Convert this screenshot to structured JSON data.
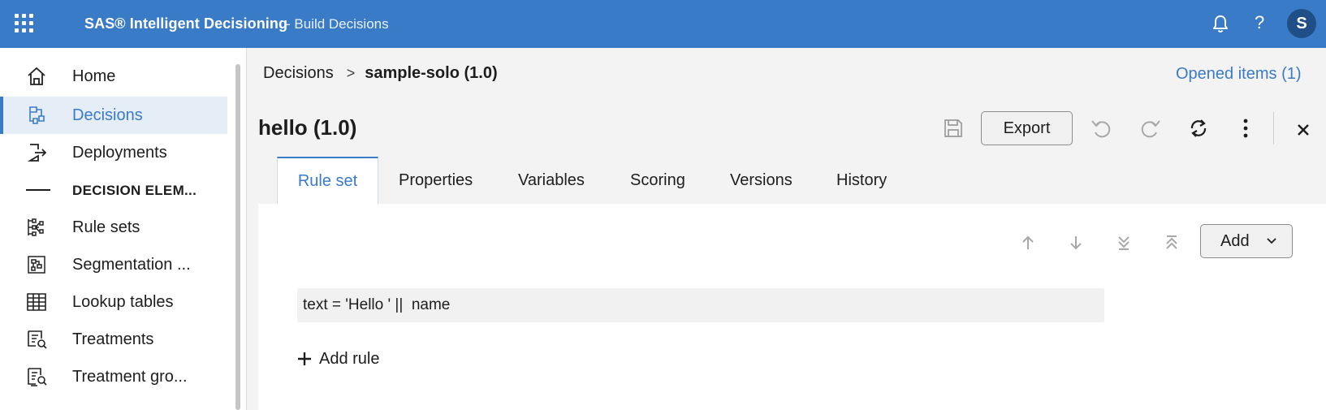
{
  "app": {
    "brand": "SAS® Intelligent Decisioning",
    "subtitle": "- Build Decisions",
    "help": "?",
    "user_initial": "S",
    "accent": "#3a7bc8"
  },
  "sidebar": {
    "items": [
      {
        "label": "Home",
        "icon": "home-icon"
      },
      {
        "label": "Decisions",
        "icon": "decisions-icon",
        "active": true
      },
      {
        "label": "Deployments",
        "icon": "deployments-icon"
      },
      {
        "label": "DECISION ELEM...",
        "icon": "dash-icon",
        "heading": true
      },
      {
        "label": "Rule sets",
        "icon": "rule-sets-icon"
      },
      {
        "label": "Segmentation ...",
        "icon": "segmentation-icon"
      },
      {
        "label": "Lookup tables",
        "icon": "lookup-table-icon"
      },
      {
        "label": "Treatments",
        "icon": "treatments-icon"
      },
      {
        "label": "Treatment gro...",
        "icon": "treatment-groups-icon"
      }
    ]
  },
  "breadcrumb": {
    "parent": "Decisions",
    "separator": ">",
    "current": "sample-solo (1.0)"
  },
  "opened_items": "Opened items (1)",
  "object": {
    "title": "hello (1.0)",
    "export_label": "Export"
  },
  "tabs": [
    {
      "label": "Rule set",
      "active": true
    },
    {
      "label": "Properties"
    },
    {
      "label": "Variables"
    },
    {
      "label": "Scoring"
    },
    {
      "label": "Versions"
    },
    {
      "label": "History"
    }
  ],
  "ruleset": {
    "add_label": "Add",
    "rules": [
      "text = 'Hello ' ||  name"
    ],
    "add_rule_label": "Add rule"
  }
}
